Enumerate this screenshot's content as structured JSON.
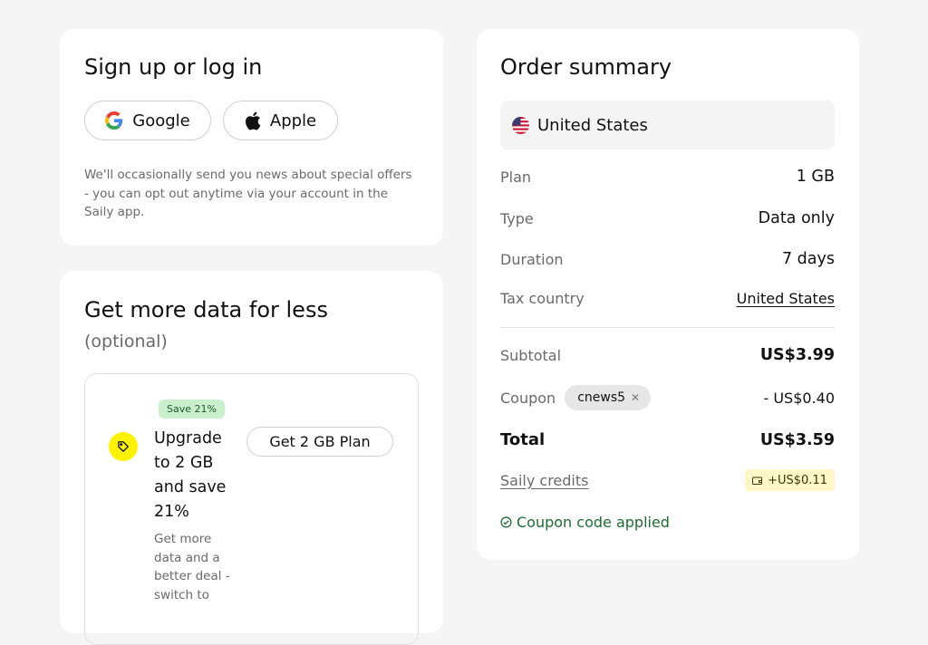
{
  "signup": {
    "title": "Sign up or log in",
    "google_label": "Google",
    "apple_label": "Apple",
    "notice": "We'll occasionally send you news about special offers - you can opt out anytime via your account in the Saily app."
  },
  "upsell": {
    "title": "Get more data for less",
    "subtitle": "(optional)",
    "badge": "Save 21%",
    "offer_title": "Upgrade to 2 GB and save 21%",
    "offer_button": "Get 2 GB Plan",
    "offer_desc": "Get more data and a better deal - switch to"
  },
  "summary": {
    "title": "Order summary",
    "country": "United States",
    "rows": {
      "plan": {
        "label": "Plan",
        "value": "1 GB"
      },
      "type": {
        "label": "Type",
        "value": "Data only"
      },
      "duration": {
        "label": "Duration",
        "value": "7 days"
      },
      "tax_country": {
        "label": "Tax country",
        "value": "United States"
      },
      "subtotal": {
        "label": "Subtotal",
        "value": "US$3.99"
      },
      "coupon": {
        "label": "Coupon",
        "code": "cnews5",
        "value": "- US$0.40"
      },
      "total": {
        "label": "Total",
        "value": "US$3.59"
      },
      "credits": {
        "label": "Saily credits",
        "value": "+US$0.11"
      }
    },
    "applied_message": "Coupon code applied"
  },
  "colors": {
    "page_bg": "#f5f5f5",
    "card_bg": "#ffffff",
    "success_green": "#1f6b35",
    "save_pill_bg": "#c9efcc",
    "highlight_yellow": "#fff200",
    "credit_badge_bg": "#fff7c8"
  },
  "icons": [
    "google-icon",
    "apple-icon",
    "tag-icon",
    "us-flag-icon",
    "close-icon",
    "wallet-icon",
    "check-circle-icon"
  ]
}
